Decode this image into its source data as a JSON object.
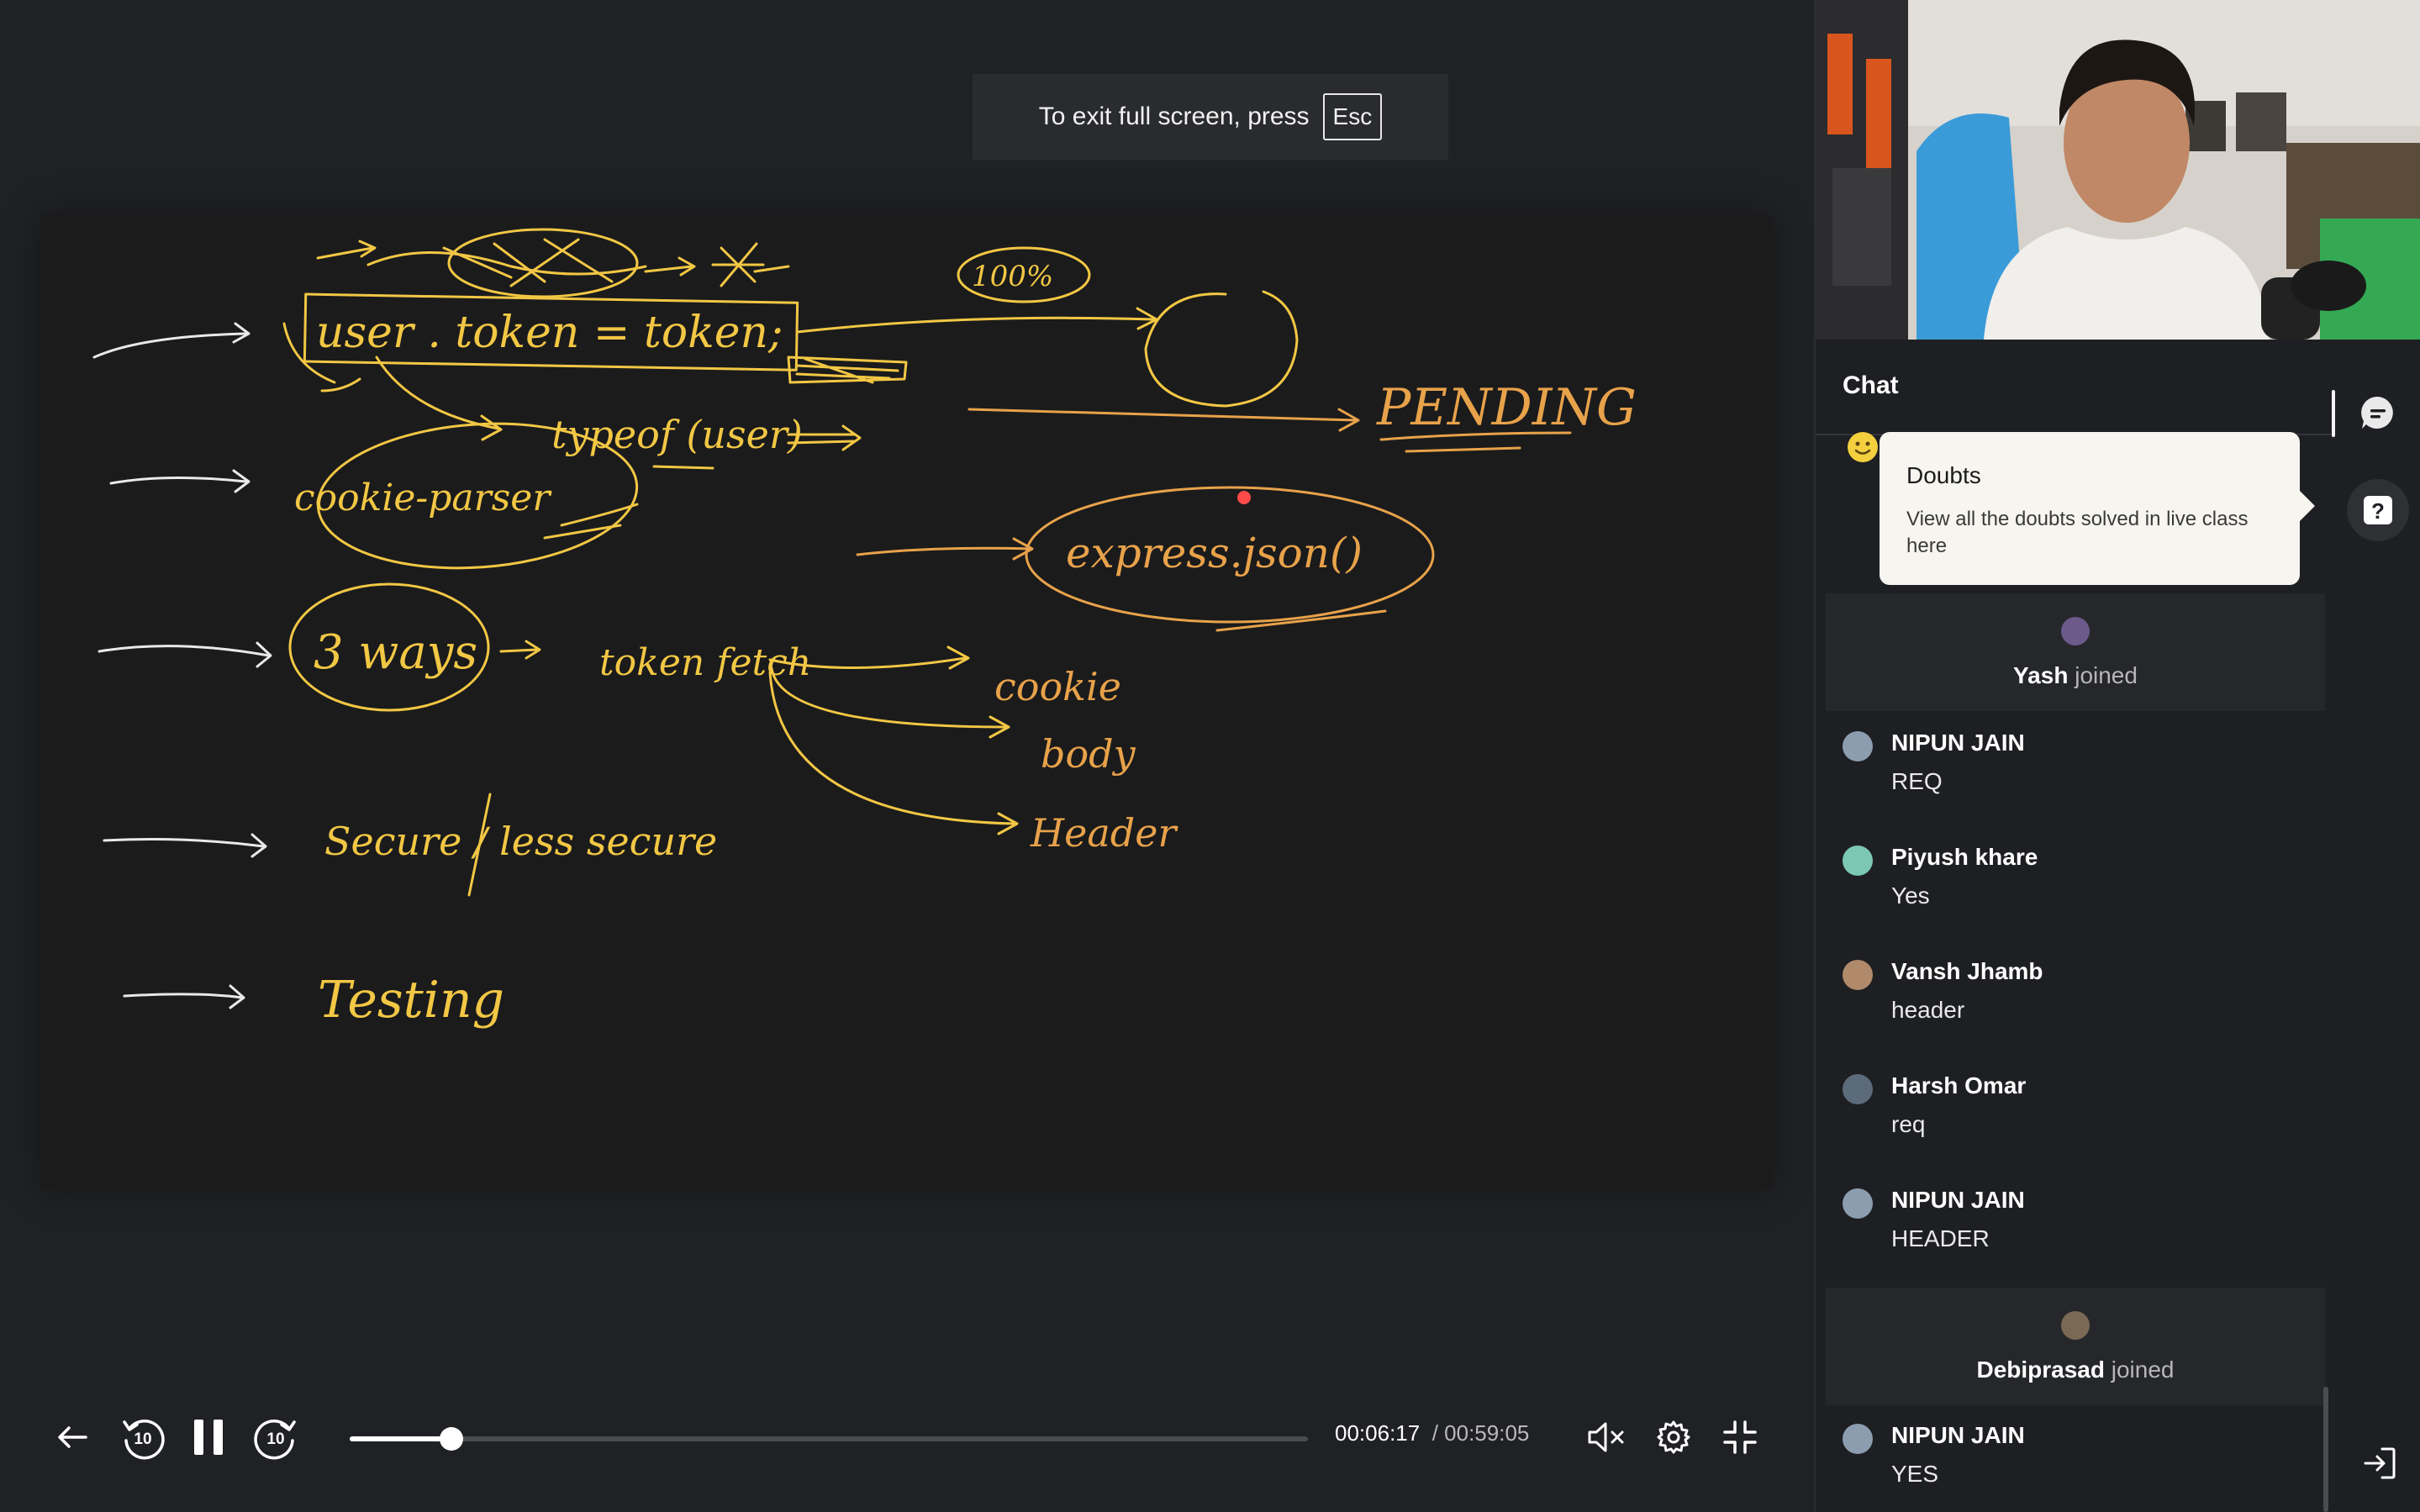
{
  "fullscreen_notice": {
    "text": "To exit full screen, press",
    "key": "Esc"
  },
  "whiteboard": {
    "texts": [
      {
        "id": "user-token",
        "text": "user . token = token;",
        "color": "#f2c744"
      },
      {
        "id": "percent",
        "text": "100%",
        "color": "#f2c744"
      },
      {
        "id": "pending",
        "text": "PENDING",
        "color": "#e8a24a"
      },
      {
        "id": "typeof",
        "text": "typeof (user)",
        "color": "#f2c744"
      },
      {
        "id": "cookie-parser",
        "text": "cookie-parser",
        "color": "#f2c744"
      },
      {
        "id": "express-json",
        "text": "express.json()",
        "color": "#e8a24a"
      },
      {
        "id": "three-ways",
        "text": "3 ways",
        "color": "#f2c744"
      },
      {
        "id": "token-fetch",
        "text": "token fetch",
        "color": "#f2c744"
      },
      {
        "id": "cookie",
        "text": "cookie",
        "color": "#e8a24a"
      },
      {
        "id": "body",
        "text": "body",
        "color": "#e8a24a"
      },
      {
        "id": "header",
        "text": "Header",
        "color": "#e8a24a"
      },
      {
        "id": "secure",
        "text": "Secure / less secure",
        "color": "#f2c744"
      },
      {
        "id": "testing",
        "text": "Testing",
        "color": "#f2c744"
      }
    ]
  },
  "player": {
    "current_time": "00:06:17",
    "separator": "/",
    "duration": "00:59:05",
    "progress": 0.1064,
    "skip_seconds": "10",
    "icons": {
      "back": "arrow-left-icon",
      "rewind": "rewind-10-icon",
      "pause": "pause-icon",
      "forward": "forward-10-icon",
      "mute": "volume-muted-icon",
      "settings": "gear-icon",
      "exit_fullscreen": "exit-fullscreen-icon"
    }
  },
  "chat": {
    "title": "Chat",
    "tooltip": {
      "title": "Doubts",
      "body": "View all the doubts solved in live class here"
    },
    "join_suffix": "joined",
    "items": [
      {
        "type": "join",
        "name": "Yash"
      },
      {
        "type": "message",
        "name": "NIPUN JAIN",
        "text": "REQ"
      },
      {
        "type": "message",
        "name": "Piyush khare",
        "text": "Yes"
      },
      {
        "type": "message",
        "name": "Vansh Jhamb",
        "text": "header"
      },
      {
        "type": "message",
        "name": "Harsh Omar",
        "text": "req"
      },
      {
        "type": "message",
        "name": "NIPUN JAIN",
        "text": "HEADER"
      },
      {
        "type": "join",
        "name": "Debiprasad"
      },
      {
        "type": "message",
        "name": "NIPUN JAIN",
        "text": "YES"
      }
    ]
  },
  "colors": {
    "background": "#202124",
    "board": "#1b1b1c",
    "ink_yellow": "#f2c744",
    "ink_orange": "#e8a24a",
    "accent_white": "#ffffff",
    "laser": "#ff4a4a"
  }
}
